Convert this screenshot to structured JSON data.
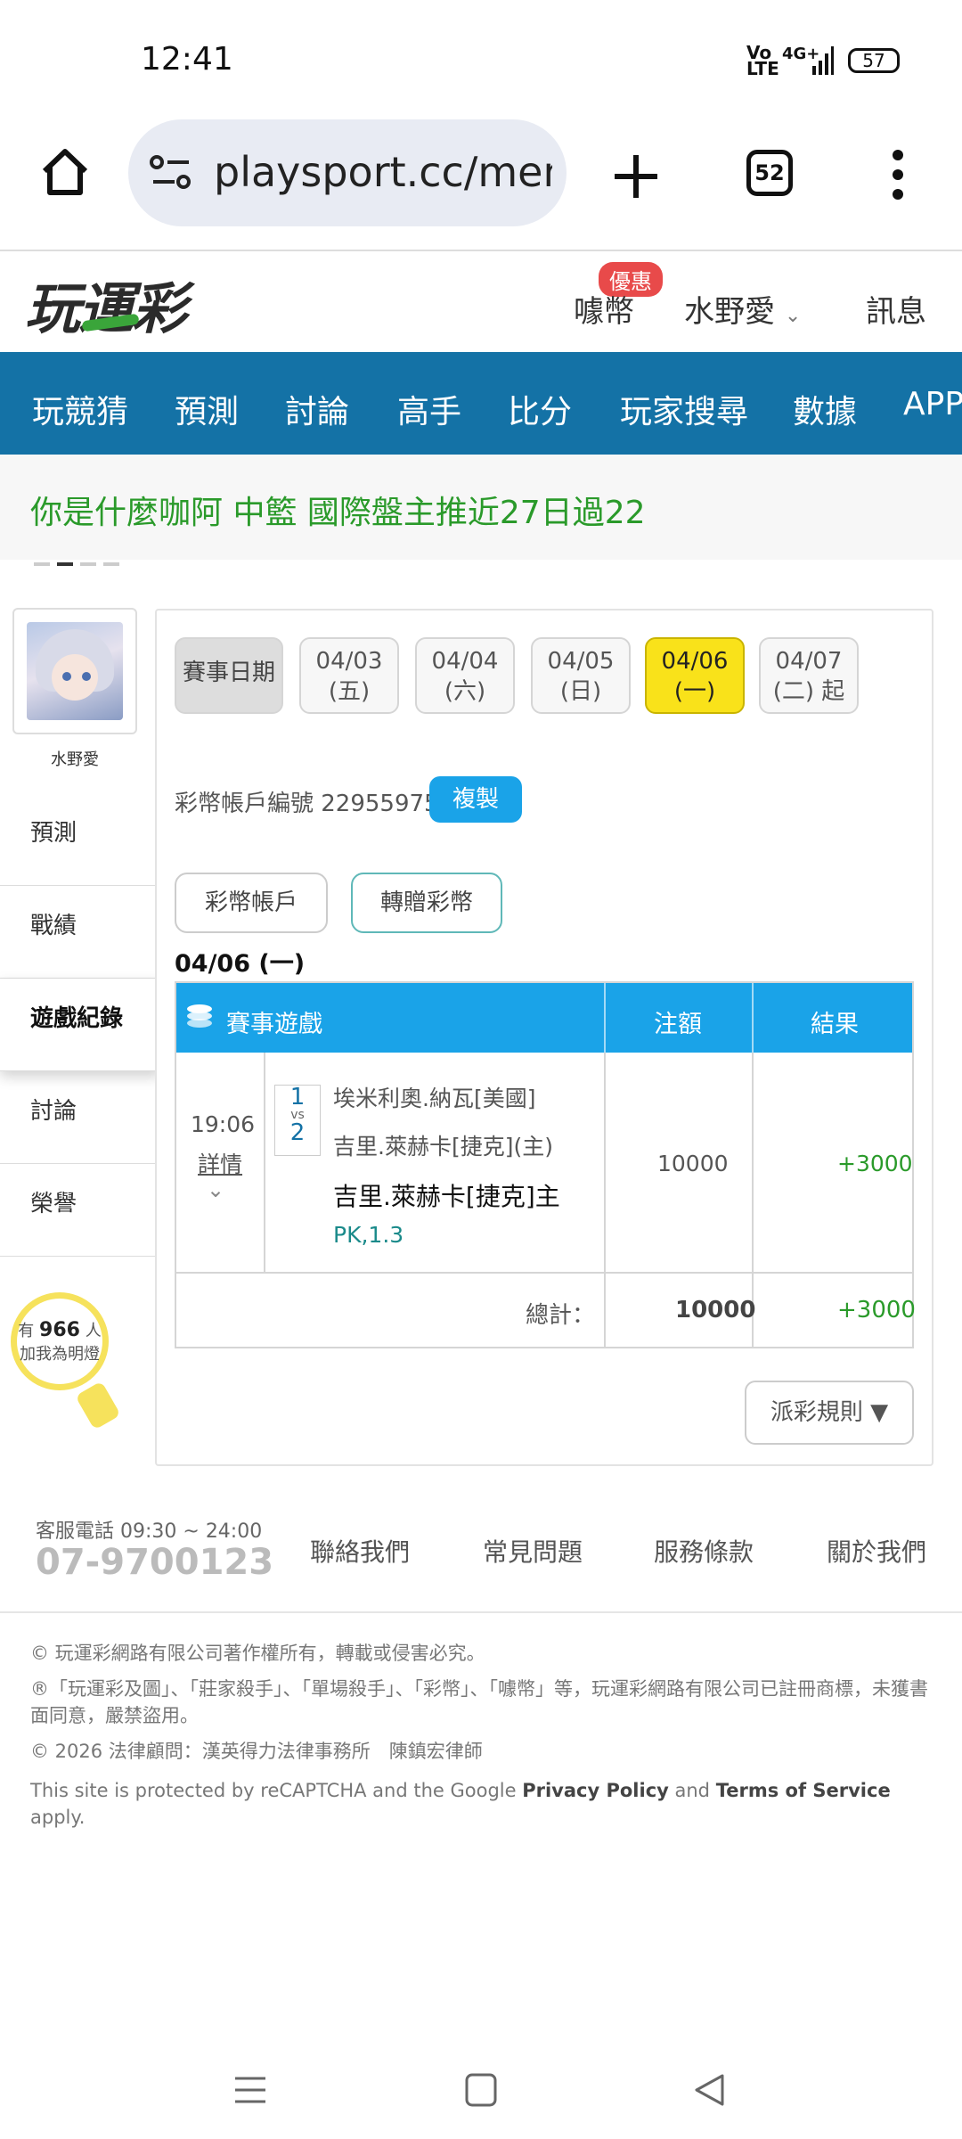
{
  "status_bar": {
    "time": "12:41",
    "network": "4G+",
    "volte": "Vo LTE",
    "battery": "57"
  },
  "browser": {
    "url": "playsport.cc/men",
    "tab_count": "52"
  },
  "site_header": {
    "logo": "玩運彩",
    "promo_badge": "優惠",
    "coins_label": "噱幣",
    "user_name": "水野愛",
    "messages_label": "訊息"
  },
  "nav": {
    "items": [
      "玩競猜",
      "預測",
      "討論",
      "高手",
      "比分",
      "玩家搜尋",
      "數據",
      "APP"
    ]
  },
  "marquee": {
    "text": "你是什麼咖阿 中籃 國際盤主推近27日過22"
  },
  "sidebar": {
    "user_name": "水野愛",
    "items": [
      "預測",
      "戰績",
      "遊戲紀錄",
      "討論",
      "榮譽"
    ],
    "active_item": "遊戲紀錄",
    "bulb": {
      "prefix": "有",
      "count": "966",
      "suffix": "人",
      "caption": "加我為明燈"
    }
  },
  "dates": {
    "label": "賽事日期",
    "items": [
      {
        "date": "04/03",
        "day": "(五)"
      },
      {
        "date": "04/04",
        "day": "(六)"
      },
      {
        "date": "04/05",
        "day": "(日)"
      },
      {
        "date": "04/06",
        "day": "(一)"
      },
      {
        "date": "04/07",
        "day": "(二) 起"
      }
    ],
    "selected": "04/06"
  },
  "account": {
    "label": "彩幣帳戶編號 22955975",
    "copy_button": "複製"
  },
  "tabs": {
    "coin_account": "彩幣帳戶",
    "transfer_coins": "轉贈彩幣"
  },
  "section_date": "04/06 (一)",
  "table": {
    "headers": {
      "game": "賽事遊戲",
      "amount": "注額",
      "result": "結果"
    },
    "rows": [
      {
        "time": "19:06",
        "detail_link": "詳情",
        "team1_no": "1",
        "vs": "vs",
        "team2_no": "2",
        "team1": "埃米利奧.納瓦[美國]",
        "team2": "吉里.萊赫卡[捷克](主)",
        "pick": "吉里.萊赫卡[捷克]主",
        "odds": "PK,1.3",
        "amount": "10000",
        "result": "+3000"
      }
    ],
    "total_label": "總計：",
    "total_amount": "10000",
    "total_result": "+3000"
  },
  "rules_button": "派彩規則 ▼",
  "footer": {
    "phone_label": "客服電話 09:30 ~ 24:00",
    "phone": "07-9700123",
    "links": [
      "聯絡我們",
      "常見問題",
      "服務條款",
      "關於我們"
    ]
  },
  "legal": {
    "copyright": "© 玩運彩網路有限公司著作權所有，轉載或侵害必究。",
    "trademark": "®「玩運彩及圖」、「莊家殺手」、「單場殺手」、「彩幣」、「噱幣」等，玩運彩網路有限公司已註冊商標，未獲書面同意，嚴禁盜用。",
    "lawyer": "© 2026 法律顧問：漢英得力法律事務所　陳鎮宏律師",
    "recaptcha_pre": "This site is protected by reCAPTCHA and the Google ",
    "privacy": "Privacy Policy",
    "and": " and ",
    "terms": "Terms of Service",
    "apply": " apply."
  },
  "colors": {
    "nav_bg": "#1472a6",
    "header_blue": "#1aa3e8",
    "selected_date": "#f9e21a",
    "positive": "#2a9a2a",
    "promo": "#e84a4a"
  }
}
